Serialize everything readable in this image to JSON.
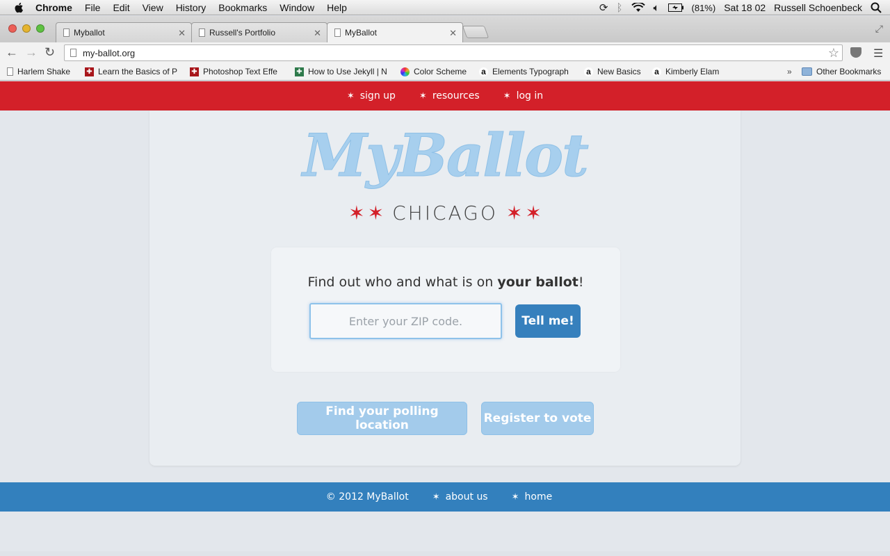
{
  "menubar": {
    "app": "Chrome",
    "items": [
      "File",
      "Edit",
      "View",
      "History",
      "Bookmarks",
      "Window",
      "Help"
    ],
    "battery": "(81%)",
    "clock": "Sat 18 02",
    "user": "Russell Schoenbeck"
  },
  "tabs": [
    {
      "title": "Myballot"
    },
    {
      "title": "Russell's Portfolio"
    },
    {
      "title": "MyBallot"
    }
  ],
  "toolbar": {
    "url": "my-ballot.org"
  },
  "bookmarks": [
    {
      "label": "Harlem Shake",
      "icon": "page-icon"
    },
    {
      "label": "Learn the Basics of P",
      "icon": "red-plus-icon"
    },
    {
      "label": "Photoshop Text Effe",
      "icon": "red-plus-icon"
    },
    {
      "label": "How to Use Jekyll | N",
      "icon": "green-plus-icon"
    },
    {
      "label": "Color Scheme",
      "icon": "color-wheel-icon"
    },
    {
      "label": "Elements Typograph",
      "icon": "amazon-icon"
    },
    {
      "label": "New Basics",
      "icon": "amazon-icon"
    },
    {
      "label": "Kimberly Elam",
      "icon": "amazon-icon"
    },
    {
      "label": "Other Bookmarks",
      "icon": "folder-icon"
    }
  ],
  "site": {
    "nav": [
      "sign up",
      "resources",
      "log in"
    ],
    "logo_script": "MyBallot",
    "logo_city": "CHICAGO",
    "prompt_pre": "Find out who and what is on ",
    "prompt_bold": "your ballot",
    "prompt_post": "!",
    "zip_placeholder": "Enter your ZIP code.",
    "submit_label": "Tell me!",
    "poll_button": "Find your polling location",
    "register_button": "Register to vote",
    "footer_copy": "© 2012 MyBallot",
    "footer_links": [
      "about us",
      "home"
    ]
  },
  "colors": {
    "nav_red": "#d32029",
    "footer_blue": "#3380bd",
    "button_blue": "#3680bd",
    "logo_blue": "#a7cfee"
  }
}
